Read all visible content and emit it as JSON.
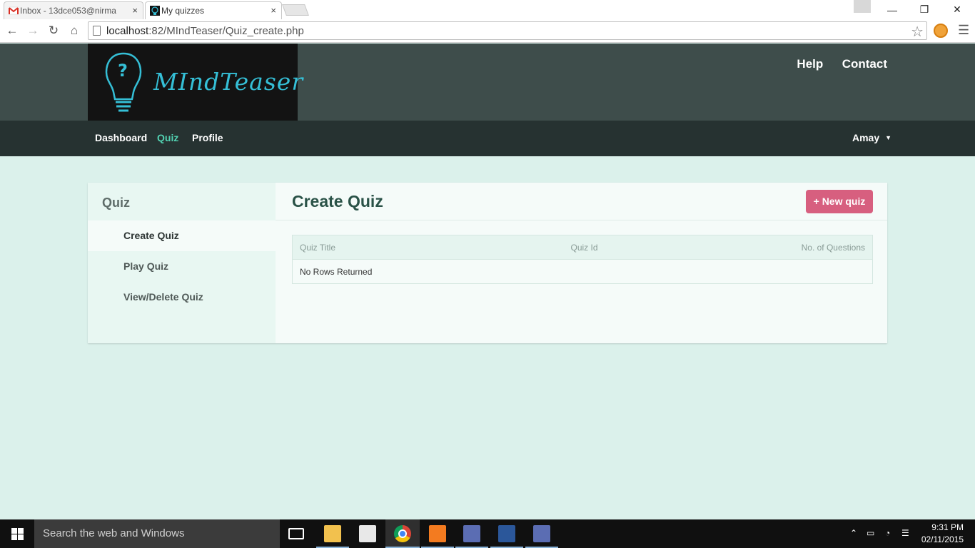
{
  "browser": {
    "tabs": [
      {
        "label": "Inbox - 13dce053@nirma",
        "close": "×"
      },
      {
        "label": "My quizzes",
        "close": "×"
      }
    ],
    "url_host": "localhost",
    "url_path": ":82/MIndTeaser/Quiz_create.php"
  },
  "site": {
    "brand": "MIndTeaser",
    "top_links": {
      "help": "Help",
      "contact": "Contact"
    },
    "nav": {
      "dashboard": "Dashboard",
      "quiz": "Quiz",
      "profile": "Profile"
    },
    "user": "Amay",
    "accent_color": "#52d1b1"
  },
  "sidebar": {
    "title": "Quiz",
    "items": [
      {
        "label": "Create Quiz"
      },
      {
        "label": "Play Quiz"
      },
      {
        "label": "View/Delete Quiz"
      }
    ]
  },
  "main": {
    "title": "Create Quiz",
    "new_button": "+ New quiz",
    "table": {
      "headers": [
        "Quiz Title",
        "Quiz Id",
        "No. of Questions"
      ],
      "empty_text": "No Rows Returned"
    }
  },
  "taskbar": {
    "search_placeholder": "Search the web and Windows",
    "time": "9:31 PM",
    "date": "02/11/2015"
  }
}
